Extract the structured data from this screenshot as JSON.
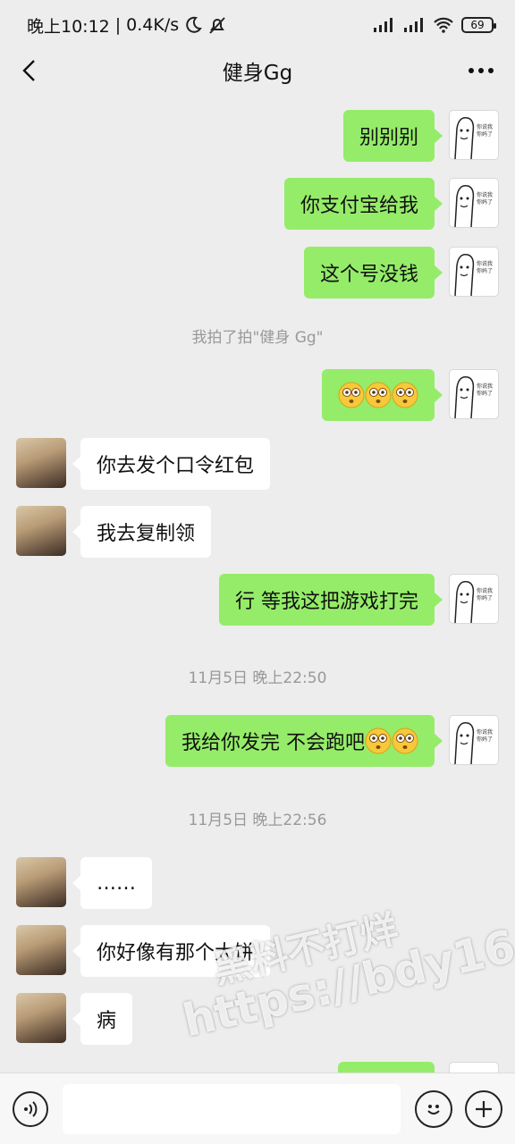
{
  "status_bar": {
    "time": "晚上10:12",
    "speed": "0.4K/s",
    "battery": "69"
  },
  "header": {
    "title": "健身Gg"
  },
  "messages": {
    "m1": "别别别",
    "m2": "你支付宝给我",
    "m3": "这个号没钱",
    "pat": "我拍了拍\"健身 Gg\"",
    "m5": "你去发个口令红包",
    "m6": "我去复制领",
    "m7": "行 等我这把游戏打完",
    "ts1": "11月5日 晚上22:50",
    "m8": "我给你发完 不会跑吧",
    "ts2": "11月5日 晚上22:56",
    "m9": "……",
    "m10": "你好像有那个大饼",
    "m11": "病"
  },
  "avatar_meme_text": "你说我干啥 你妈了个巴",
  "watermark": {
    "line1": "黑料不打烊",
    "line2": "https://bdy16.co"
  },
  "input": {
    "placeholder": ""
  },
  "colors": {
    "outgoing_bubble": "#95ec69",
    "incoming_bubble": "#ffffff",
    "background": "#ededed"
  },
  "icons": {
    "back": "chevron-left-icon",
    "more": "more-dots-icon",
    "voice": "voice-icon",
    "emoji": "smile-icon",
    "plus": "plus-icon",
    "bubble_emoji": "flushed-face-emoji"
  }
}
